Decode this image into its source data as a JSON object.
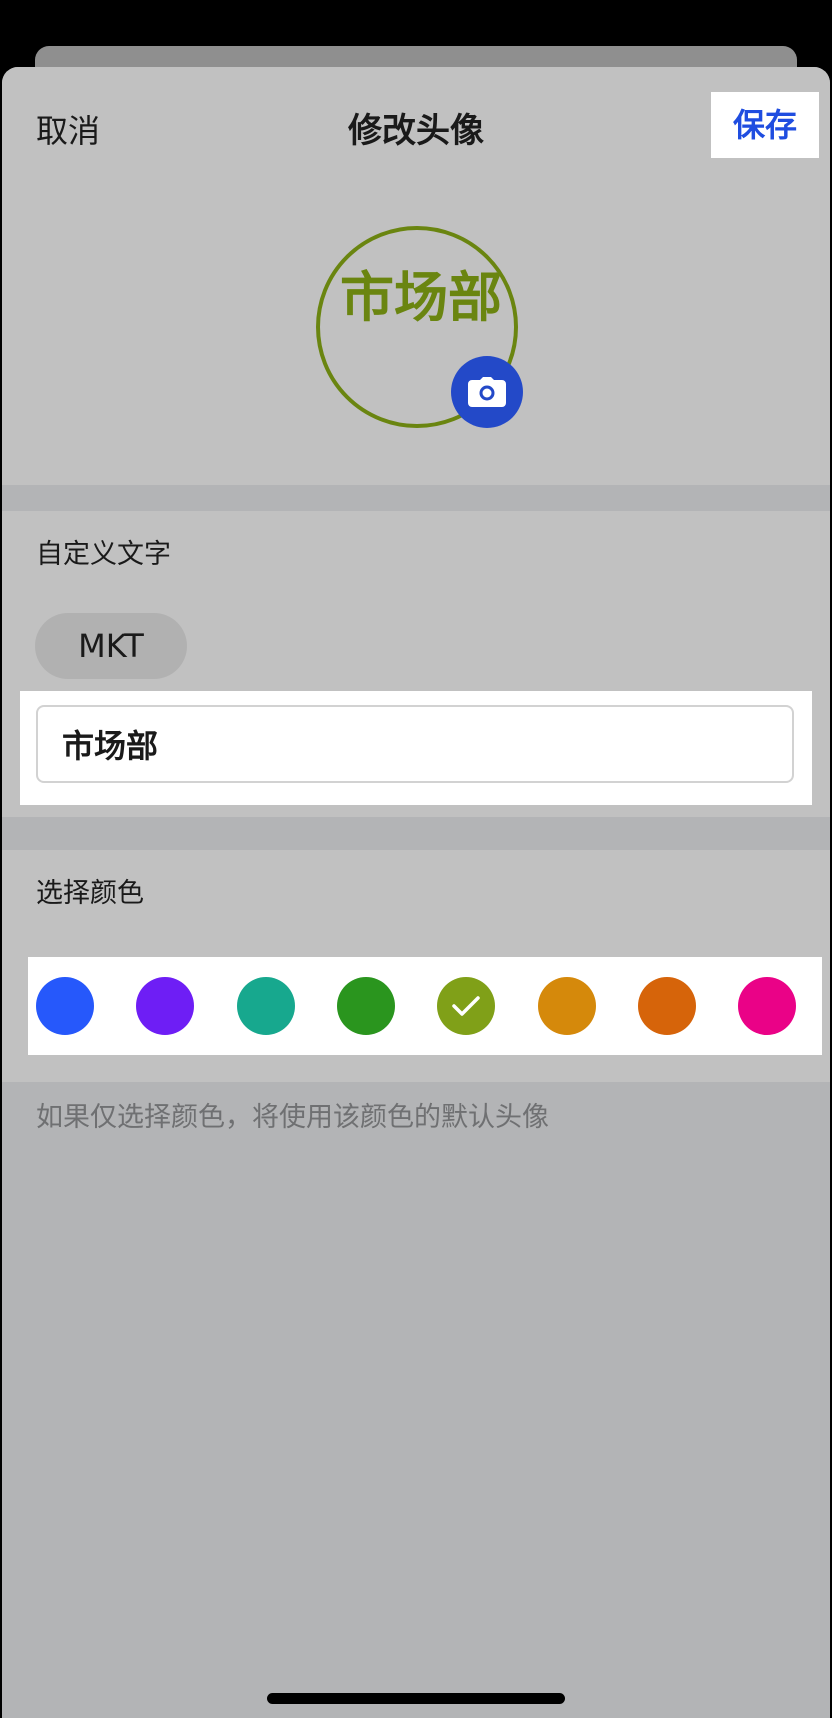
{
  "header": {
    "cancel_label": "取消",
    "title": "修改头像",
    "save_label": "保存"
  },
  "avatar": {
    "text": "市场部",
    "border_color": "#6a8510",
    "text_color": "#6a8510",
    "camera_icon": "camera-icon",
    "camera_badge_color": "#2349c8"
  },
  "custom_text": {
    "label": "自定义文字",
    "chip_label": "MKT",
    "input_value": "市场部"
  },
  "color_picker": {
    "label": "选择颜色",
    "selected_index": 4,
    "colors": [
      {
        "hex": "#2658fb"
      },
      {
        "hex": "#6e1ef5"
      },
      {
        "hex": "#17a88e"
      },
      {
        "hex": "#2a951e"
      },
      {
        "hex": "#80a018"
      },
      {
        "hex": "#d5890b"
      },
      {
        "hex": "#d6640a"
      },
      {
        "hex": "#ea0287"
      }
    ]
  },
  "hint": "如果仅选择颜色，将使用该颜色的默认头像"
}
